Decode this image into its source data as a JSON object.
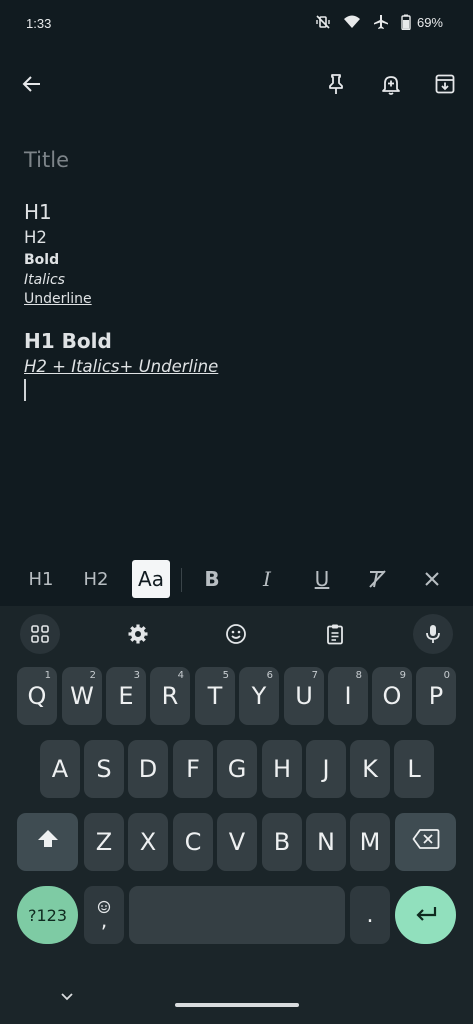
{
  "status": {
    "time": "1:33",
    "battery": "69%",
    "icons": [
      "vibrate-off-icon",
      "wifi-icon",
      "airplane-icon",
      "battery-icon"
    ]
  },
  "topbar": {
    "icons": [
      "back-arrow-icon",
      "pin-icon",
      "reminder-bell-icon",
      "archive-icon"
    ]
  },
  "note": {
    "title_placeholder": "Title",
    "lines": {
      "h1": "H1",
      "h2": "H2",
      "bold": "Bold",
      "italics": "Italics",
      "underline": "Underline",
      "h1_bold": "H1 Bold",
      "h2_italics_underline": "H2 + Italics+ Underline"
    }
  },
  "format_bar": {
    "h1": "H1",
    "h2": "H2",
    "normal": "Aa",
    "bold": "B",
    "italic": "I",
    "underline": "U",
    "icons": [
      "clear-format-icon",
      "close-icon"
    ],
    "selected": "Aa"
  },
  "keyboard": {
    "toolbar_icons": [
      "apps-grid-icon",
      "settings-gear-icon",
      "emoji-icon",
      "clipboard-icon",
      "microphone-icon"
    ],
    "row1": [
      {
        "k": "Q",
        "h": "1"
      },
      {
        "k": "W",
        "h": "2"
      },
      {
        "k": "E",
        "h": "3"
      },
      {
        "k": "R",
        "h": "4"
      },
      {
        "k": "T",
        "h": "5"
      },
      {
        "k": "Y",
        "h": "6"
      },
      {
        "k": "U",
        "h": "7"
      },
      {
        "k": "I",
        "h": "8"
      },
      {
        "k": "O",
        "h": "9"
      },
      {
        "k": "P",
        "h": "0"
      }
    ],
    "row2": [
      "A",
      "S",
      "D",
      "F",
      "G",
      "H",
      "J",
      "K",
      "L"
    ],
    "row3": [
      "Z",
      "X",
      "C",
      "V",
      "B",
      "N",
      "M"
    ],
    "symbols_label": "?123",
    "comma": ",",
    "period": ".",
    "accent": "#7ecba4"
  }
}
